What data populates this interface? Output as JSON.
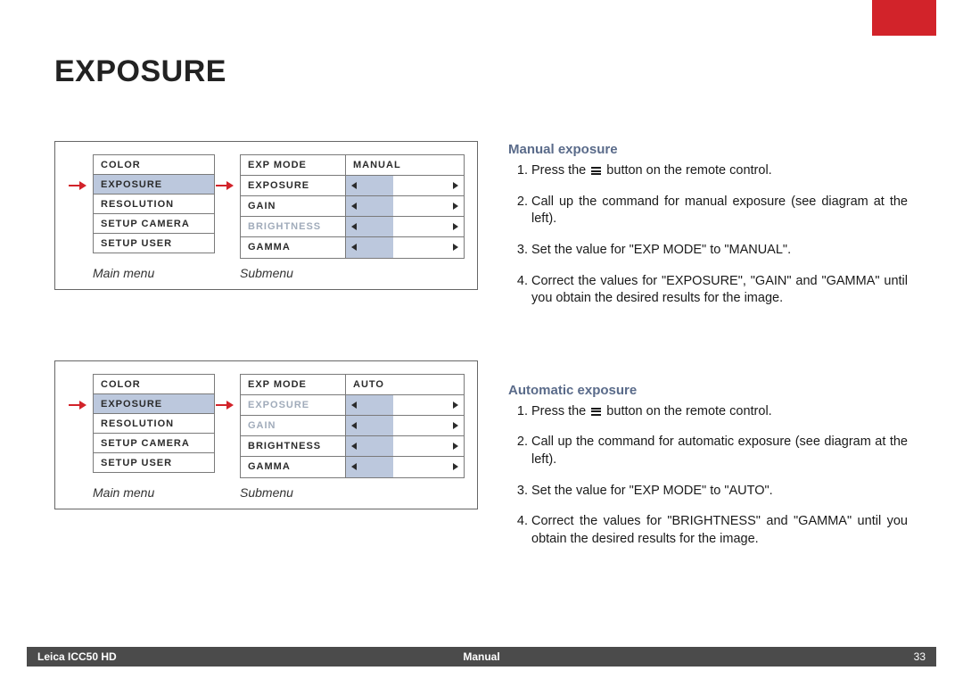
{
  "page_title": "EXPOSURE",
  "diagrams": [
    {
      "main_menu": {
        "items": [
          "COLOR",
          "EXPOSURE",
          "RESOLUTION",
          "SETUP CAMERA",
          "SETUP USER"
        ],
        "selected_index": 1
      },
      "submenu": {
        "rows": [
          {
            "label": "EXP MODE",
            "type": "value",
            "value": "MANUAL",
            "dim": false
          },
          {
            "label": "EXPOSURE",
            "type": "slider",
            "fill_pct": 40,
            "dim": false
          },
          {
            "label": "GAIN",
            "type": "slider",
            "fill_pct": 40,
            "dim": false
          },
          {
            "label": "BRIGHTNESS",
            "type": "slider",
            "fill_pct": 40,
            "dim": true
          },
          {
            "label": "GAMMA",
            "type": "slider",
            "fill_pct": 40,
            "dim": false
          }
        ]
      },
      "caption_left": "Main menu",
      "caption_right": "Submenu"
    },
    {
      "main_menu": {
        "items": [
          "COLOR",
          "EXPOSURE",
          "RESOLUTION",
          "SETUP CAMERA",
          "SETUP USER"
        ],
        "selected_index": 1
      },
      "submenu": {
        "rows": [
          {
            "label": "EXP MODE",
            "type": "value",
            "value": "AUTO",
            "dim": false
          },
          {
            "label": "EXPOSURE",
            "type": "slider",
            "fill_pct": 40,
            "dim": true
          },
          {
            "label": "GAIN",
            "type": "slider",
            "fill_pct": 40,
            "dim": true
          },
          {
            "label": "BRIGHTNESS",
            "type": "slider",
            "fill_pct": 40,
            "dim": false
          },
          {
            "label": "GAMMA",
            "type": "slider",
            "fill_pct": 40,
            "dim": false
          }
        ]
      },
      "caption_left": "Main menu",
      "caption_right": "Submenu"
    }
  ],
  "sections": [
    {
      "title": "Manual exposure",
      "steps": [
        "Press the ≣ button on the remote control.",
        "Call up the command for manual exposure (see diagram at the left).",
        "Set the value for \"EXP MODE\" to \"MANUAL\".",
        "Correct the values for \"EXPOSURE\", \"GAIN\" and \"GAMMA\" until you obtain the desired results for the image."
      ]
    },
    {
      "title": "Automatic exposure",
      "steps": [
        "Press the ≣ button on the remote control.",
        "Call up the command for automatic exposure (see diagram at the left).",
        "Set the value for \"EXP MODE\" to \"AUTO\".",
        "Correct the values for \"BRIGHTNESS\" and \"GAMMA\" until you obtain the desired results for the image."
      ]
    }
  ],
  "footer": {
    "left": "Leica ICC50 HD",
    "center": "Manual",
    "right": "33"
  }
}
